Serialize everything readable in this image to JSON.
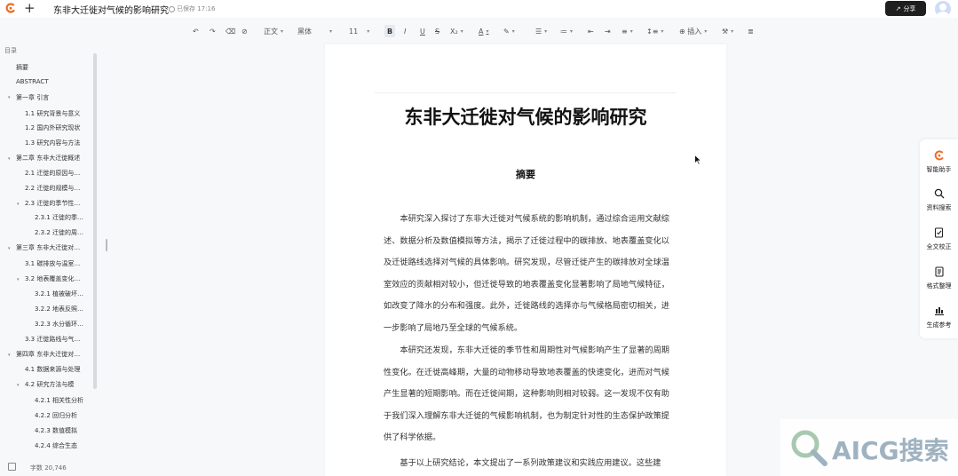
{
  "header": {
    "doc_title": "东非大迁徙对气候的影响研究",
    "saved_status": "已保存 17:16",
    "share_label": "分享"
  },
  "toolbar": {
    "style_select": "正文",
    "font_select": "黑体",
    "size_select": "11",
    "insert_label": "插入"
  },
  "outline": {
    "title": "目录",
    "items": [
      {
        "label": "摘要"
      },
      {
        "label": "ABSTRACT"
      },
      {
        "label": "第一章 引言"
      },
      {
        "label": "1.1 研究背景与意义"
      },
      {
        "label": "1.2 国内外研究现状"
      },
      {
        "label": "1.3 研究内容与方法"
      },
      {
        "label": "第二章 东非大迁徙概述"
      },
      {
        "label": "2.1 迁徙的原因与…"
      },
      {
        "label": "2.2 迁徙的规模与…"
      },
      {
        "label": "2.3 迁徙的季节性…"
      },
      {
        "label": "2.3.1 迁徙的季…"
      },
      {
        "label": "2.3.2 迁徙的周…"
      },
      {
        "label": "第三章 东非大迁徙对…"
      },
      {
        "label": "3.1 碳排放与温室…"
      },
      {
        "label": "3.2 地表覆盖变化…"
      },
      {
        "label": "3.2.1 植被破坏…"
      },
      {
        "label": "3.2.2 地表反照…"
      },
      {
        "label": "3.2.3 水分循环…"
      },
      {
        "label": "3.3 迁徙路线与气…"
      },
      {
        "label": "第四章 东非大迁徙对…"
      },
      {
        "label": "4.1 数据来源与处理"
      },
      {
        "label": "4.2 研究方法与模"
      },
      {
        "label": "4.2.1 相关性分析"
      },
      {
        "label": "4.2.2 回归分析"
      },
      {
        "label": "4.2.3 数值模拟"
      },
      {
        "label": "4.2.4 综合生态"
      }
    ],
    "word_count": "字数 20,746"
  },
  "document": {
    "title": "东非大迁徙对气候的影响研究",
    "abstract_heading": "摘要",
    "paragraphs": [
      "本研究深入探讨了东非大迁徙对气候系统的影响机制，通过综合运用文献综述、数据分析及数值模拟等方法，揭示了迁徙过程中的碳排放、地表覆盖变化以及迁徙路线选择对气候的具体影响。研究发现，尽管迁徙产生的碳排放对全球温室效应的贡献相对较小，但迁徙导致的地表覆盖变化显著影响了局地气候特征，如改变了降水的分布和强度。此外，迁徙路线的选择亦与气候格局密切相关，进一步影响了局地乃至全球的气候系统。",
      "本研究还发现，东非大迁徙的季节性和周期性对气候影响产生了显著的周期性变化。在迁徙高峰期，大量的动物移动导致地表覆盖的快速变化，进而对气候产生显著的短期影响。而在迁徙间期，这种影响则相对较弱。这一发现不仅有助于我们深入理解东非大迁徙的气候影响机制，也为制定针对性的生态保护政策提供了科学依据。",
      "基于以上研究结论，本文提出了一系列政策建议和实践应用建议。这些建"
    ]
  },
  "right_panel": {
    "items": [
      {
        "label": "智能助手",
        "icon": "assistant-logo-icon"
      },
      {
        "label": "资料搜索",
        "icon": "search-icon"
      },
      {
        "label": "全文校正",
        "icon": "proofread-icon"
      },
      {
        "label": "格式整理",
        "icon": "format-icon"
      },
      {
        "label": "生成参考",
        "icon": "reference-icon"
      }
    ]
  },
  "watermark": {
    "text": "AICG搜索"
  },
  "colors": {
    "brand_orange": "#f06a22",
    "share_button_bg": "#1f1f1f",
    "page_bg": "#ffffff",
    "app_bg": "#f7f8fa"
  }
}
